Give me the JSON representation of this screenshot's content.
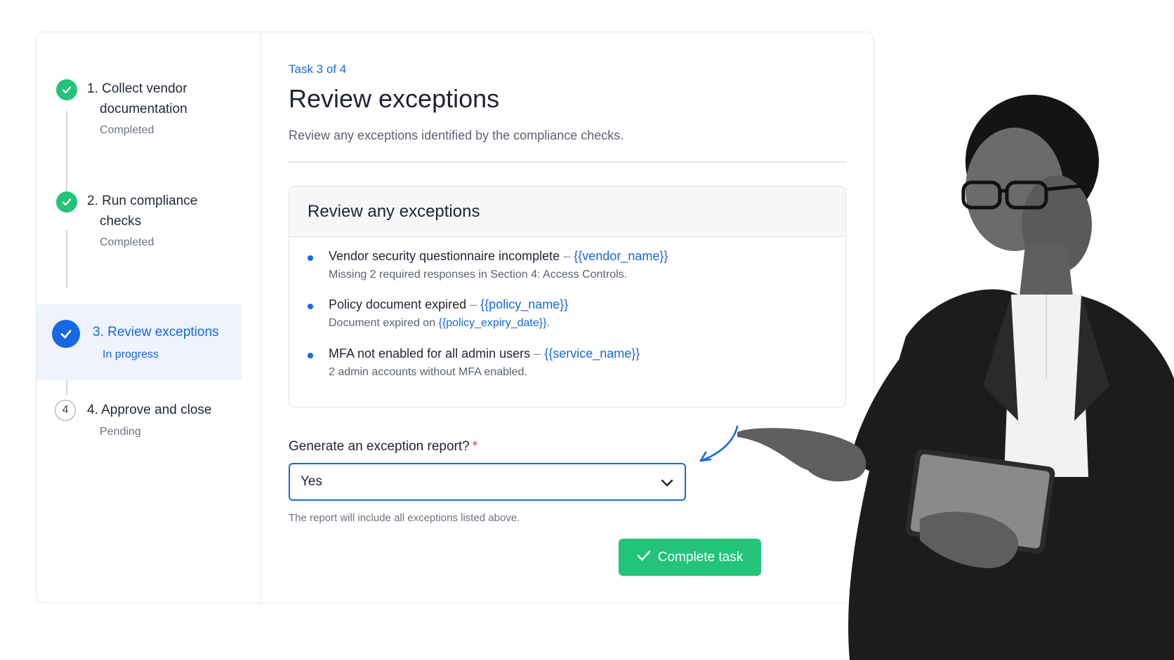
{
  "steps": [
    {
      "number": "1",
      "title_line1": "1. Collect vendor",
      "title_line2": "documentation",
      "status": "Completed",
      "state": "done"
    },
    {
      "number": "2",
      "title_line1": "2. Run compliance",
      "title_line2": "checks",
      "status": "Completed",
      "state": "done"
    },
    {
      "number": "3",
      "title_line1": "3. Review exceptions",
      "title_line2": "",
      "status": "In progress",
      "state": "current"
    },
    {
      "number": "4",
      "title_line1": "4. Approve and close",
      "title_line2": "",
      "status": "Pending",
      "state": "pending"
    }
  ],
  "task": {
    "counter": "Task 3 of 4",
    "title": "Review exceptions",
    "subtitle": "Review any exceptions identified by the compliance checks."
  },
  "exceptions": {
    "heading": "Review any exceptions",
    "items": [
      {
        "title": "Vendor security questionnaire incomplete",
        "dash": "–",
        "token": "{{vendor_name}}",
        "detail": "Missing 2 required responses in Section 4: Access Controls.",
        "detail_token": "",
        "detail_suffix": ""
      },
      {
        "title": "Policy document expired",
        "dash": "–",
        "token": "{{policy_name}}",
        "detail": "Document expired on ",
        "detail_token": "{{policy_expiry_date}}",
        "detail_suffix": "."
      },
      {
        "title": "MFA not enabled for all admin users",
        "dash": "–",
        "token": "{{service_name}}",
        "detail": "2 admin accounts without MFA enabled.",
        "detail_token": "",
        "detail_suffix": ""
      }
    ]
  },
  "report_field": {
    "label": "Generate an exception report?",
    "required_mark": "*",
    "value": "Yes",
    "hint": "The report will include all exceptions listed above."
  },
  "actions": {
    "complete_label": "Complete task"
  },
  "icons": {
    "done": "check-circle-icon",
    "current": "check-circle-icon",
    "select": "chevron-down-icon",
    "button": "check-icon",
    "annotation": "curved-arrow-icon"
  },
  "colors": {
    "accent": "#1668e3",
    "success": "#22c47a",
    "required": "#e0393e"
  }
}
